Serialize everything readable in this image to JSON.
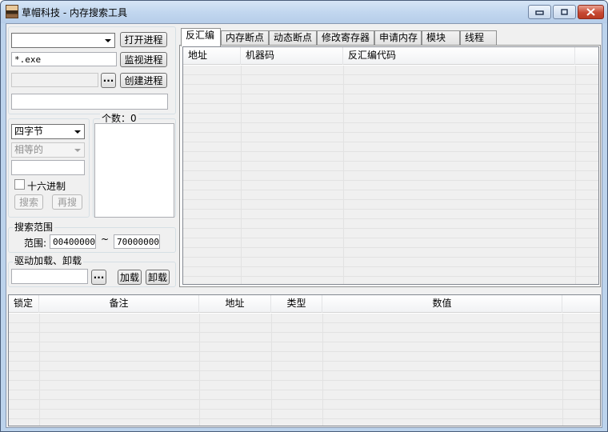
{
  "window": {
    "title": "草帽科技 - 内存搜索工具",
    "min_label": "▭",
    "max_label": "▫",
    "close_label": "✕",
    "icon": "app-icon"
  },
  "process": {
    "combo_value": "",
    "open_label": "打开进程",
    "filter_value": "*.exe",
    "monitor_label": "监视进程",
    "exe_path_value": "",
    "browse_label": "···",
    "create_label": "创建进程",
    "status_value": ""
  },
  "search": {
    "type_value": "四字节",
    "compare_value": "相等的",
    "value_input": "",
    "hex_label": "十六进制",
    "hex_checked": false,
    "search_label": "搜索",
    "research_label": "再搜",
    "count_label": "个数：0"
  },
  "range": {
    "group_label": "搜索范围",
    "range_label": "范围:",
    "start_value": "00400000",
    "tilde": "~",
    "end_value": "70000000"
  },
  "driver": {
    "group_label": "驱动加载、卸载",
    "path_value": "",
    "browse_label": "···",
    "load_label": "加载",
    "unload_label": "卸载"
  },
  "tabs": [
    {
      "label": "反汇编",
      "active": true
    },
    {
      "label": "内存断点",
      "active": false
    },
    {
      "label": "动态断点",
      "active": false
    },
    {
      "label": "修改寄存器",
      "active": false
    },
    {
      "label": "申请内存",
      "active": false
    },
    {
      "label": "模块",
      "active": false
    },
    {
      "label": "线程",
      "active": false
    }
  ],
  "disasm": {
    "columns": [
      "地址",
      "机器码",
      "反汇编代码"
    ]
  },
  "bottom": {
    "columns": [
      "锁定",
      "备注",
      "地址",
      "类型",
      "数值"
    ]
  }
}
